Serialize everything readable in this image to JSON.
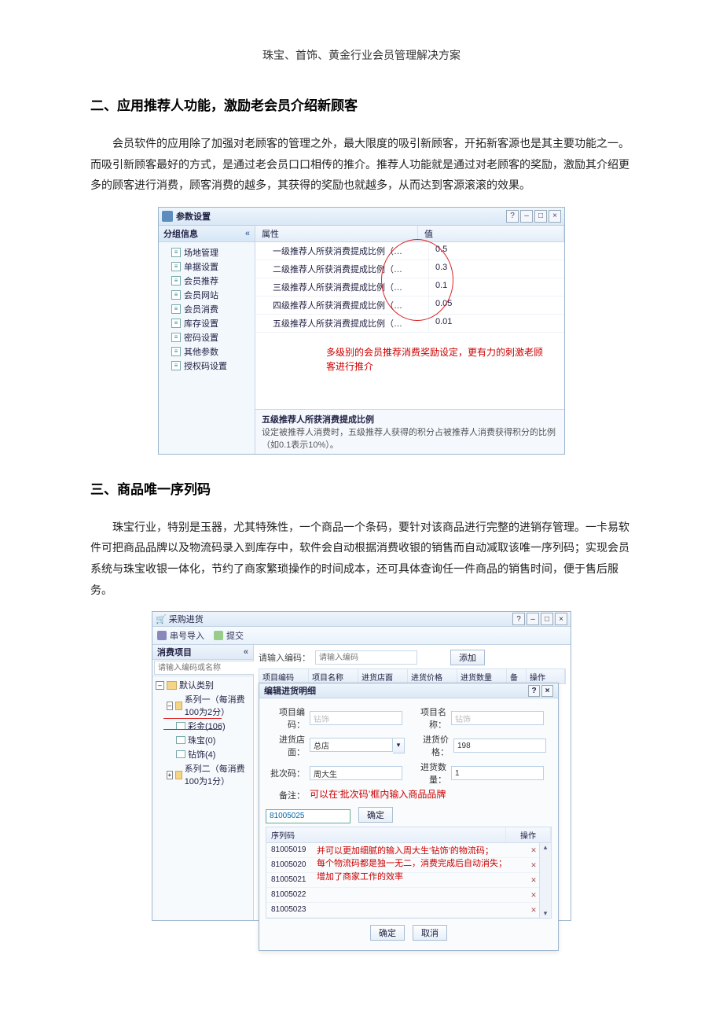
{
  "doc": {
    "header": "珠宝、首饰、黄金行业会员管理解决方案",
    "section2_title": "二、应用推荐人功能，激励老会员介绍新顾客",
    "section2_body": "会员软件的应用除了加强对老顾客的管理之外，最大限度的吸引新顾客，开拓新客源也是其主要功能之一。而吸引新顾客最好的方式，是通过老会员口口相传的推介。推荐人功能就是通过对老顾客的奖励，激励其介绍更多的顾客进行消费，顾客消费的越多，其获得的奖励也就越多，从而达到客源滚滚的效果。",
    "section3_title": "三、商品唯一序列码",
    "section3_body": "珠宝行业，特别是玉器，尤其特殊性，一个商品一个条码，要针对该商品进行完整的进销存管理。一卡易软件可把商品品牌以及物流码录入到库存中，软件会自动根据消费收银的销售而自动减取该唯一序列码；实现会员系统与珠宝收银一体化，节约了商家繁琐操作的时间成本，还可具体查询任一件商品的销售时间，便于售后服务。"
  },
  "win1": {
    "title": "参数设置",
    "sidebar_header": "分组信息",
    "tree": [
      "场地管理",
      "单据设置",
      "会员推荐",
      "会员网站",
      "会员消费",
      "库存设置",
      "密码设置",
      "其他参数",
      "授权码设置"
    ],
    "cols": {
      "attr": "属性",
      "val": "值"
    },
    "rows": [
      {
        "attr": "一级推荐人所获消费提成比例（…",
        "val": "0.5"
      },
      {
        "attr": "二级推荐人所获消费提成比例（…",
        "val": "0.3"
      },
      {
        "attr": "三级推荐人所获消费提成比例（…",
        "val": "0.1"
      },
      {
        "attr": "四级推荐人所获消费提成比例（…",
        "val": "0.05"
      },
      {
        "attr": "五级推荐人所获消费提成比例（…",
        "val": "0.01"
      }
    ],
    "annot": "多级别的会员推荐消费奖励设定，更有力的刺激老顾客进行推介",
    "help_title": "五级推荐人所获消费提成比例",
    "help_body": "设定被推荐人消费时，五级推荐人获得的积分占被推荐人消费获得积分的比例（如0.1表示10%）。"
  },
  "win2": {
    "title": "采购进货",
    "toolbar": {
      "import": "串号导入",
      "submit": "提交"
    },
    "sidebar": {
      "header": "消费项目",
      "search_placeholder": "请输入编码或名称",
      "tree": {
        "root": "默认类别",
        "s1": "系列一（每消费100为2分）",
        "s1a": "彩金(106)",
        "s1b": "珠宝(0)",
        "s1c": "钻饰(4)",
        "s2": "系列二（每消费100为1分）"
      }
    },
    "topbar": {
      "label": "请输入编码：",
      "placeholder": "请输入编码",
      "add": "添加"
    },
    "gridcols": [
      "项目编码",
      "项目名称",
      "进货店面",
      "进货价格",
      "进货数量",
      "备注",
      "操作"
    ],
    "dialog": {
      "title": "编辑进货明细",
      "f_code": "项目编码：",
      "f_code_val": "钻饰",
      "f_name": "项目名称：",
      "f_name_val": "钻饰",
      "f_store": "进货店面：",
      "f_store_val": "总店",
      "f_price": "进货价格：",
      "f_price_val": "198",
      "f_batch": "批次码：",
      "f_batch_val": "周大生",
      "f_qty": "进货数量：",
      "f_qty_val": "1",
      "f_remark": "备注：",
      "remark_annot": "可以在‘批次码’框内输入商品品牌",
      "serial_input": "81005025",
      "serial_confirm": "确定",
      "serial_hdr": "序列码",
      "serial_ops": "操作",
      "serials": [
        "81005019",
        "81005020",
        "81005021",
        "81005022",
        "81005023"
      ],
      "serial_annot": "并可以更加细腻的输入周大生‘钻饰’的物流码；\n每个物流码都是独一无二，消费完成后自动消失；增加了商家工作的效率",
      "ok": "确定",
      "cancel": "取消"
    }
  }
}
